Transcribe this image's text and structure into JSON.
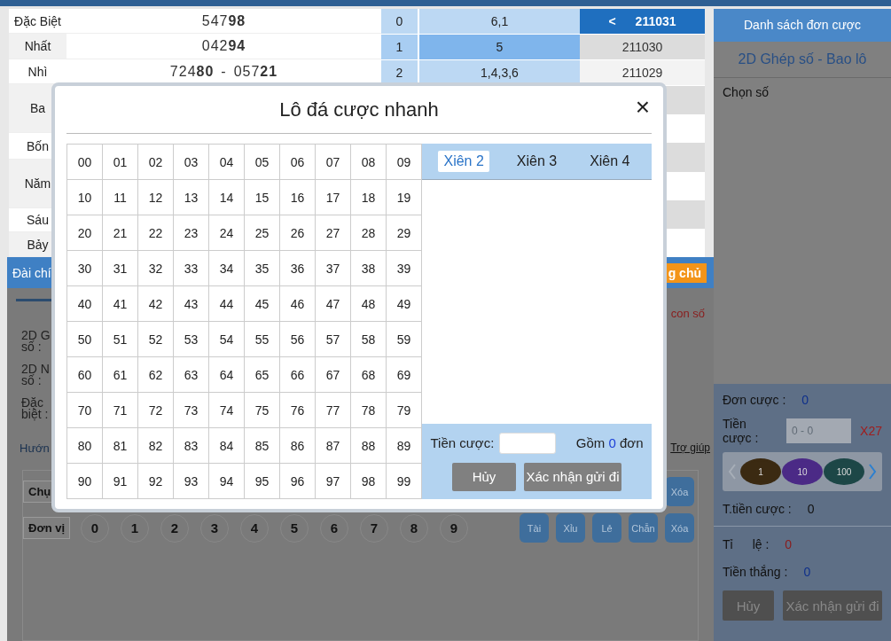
{
  "results": [
    {
      "label": "Đặc Biệt",
      "value": "547**98**"
    },
    {
      "label": "Nhất",
      "value": "042**94**"
    },
    {
      "label": "Nhì",
      "values": [
        "724**80**",
        "057**21**"
      ],
      "separator": "-"
    },
    {
      "label": "Ba"
    },
    {
      "label": "Bốn"
    },
    {
      "label": "Năm"
    },
    {
      "label": "Sáu"
    },
    {
      "label": "Bảy"
    }
  ],
  "heads": [
    {
      "digit": "0",
      "tails": "6,1",
      "highlighted": false
    },
    {
      "digit": "1",
      "tails": "5",
      "highlighted": true
    },
    {
      "digit": "2",
      "tails": "1,4,3,6",
      "highlighted": false
    }
  ],
  "draws": {
    "prev": "<",
    "items": [
      {
        "id": "211031",
        "selected": true
      },
      {
        "id": "211030",
        "selected": false
      },
      {
        "id": "211029",
        "selected": false
      }
    ]
  },
  "lower": {
    "station_bar": "Đài chí",
    "station_button": "g chủ",
    "hint": "con số",
    "fields": [
      {
        "lines": [
          "2D G",
          "số :"
        ]
      },
      {
        "lines": [
          "2D N",
          "số :"
        ]
      },
      {
        "lines": [
          "Đặc",
          "biệt :"
        ]
      }
    ],
    "guide_link": "Hướn",
    "help_link": "Trợ giúp",
    "rows": [
      {
        "button": "Chụ",
        "actions": [
          "Xóa"
        ]
      },
      {
        "button": "Đơn vị",
        "digits": [
          "0",
          "1",
          "2",
          "3",
          "4",
          "5",
          "6",
          "7",
          "8",
          "9"
        ],
        "actions": [
          "Tài",
          "Xỉu",
          "Lẻ",
          "Chẵn",
          "Xóa"
        ]
      }
    ]
  },
  "slip": {
    "title": "Danh sách đơn cược",
    "game": "2D Ghép số - Bao lô",
    "choose": "Chọn số",
    "count": {
      "label": "Đơn cược :",
      "value": "0"
    },
    "amount": {
      "label": "Tiền cược :",
      "placeholder": "0 - 0",
      "multiplier": "X27"
    },
    "chips": [
      {
        "label": "1",
        "color": "#3b2a12"
      },
      {
        "label": "10",
        "color": "#4b2a86"
      },
      {
        "label": "100",
        "color": "#1d4747"
      }
    ],
    "total": {
      "label": "T.tiền cược :",
      "value": "0"
    },
    "rate": {
      "label": "Tỉ",
      "label2": "lệ :",
      "value": "0"
    },
    "win": {
      "label": "Tiền thắng :",
      "value": "0"
    },
    "buttons": [
      "Hủy",
      "Xác nhận gửi đi"
    ]
  },
  "modal": {
    "title": "Lô đá cược nhanh",
    "close": "×",
    "grid": [
      [
        "00",
        "01",
        "02",
        "03",
        "04",
        "05",
        "06",
        "07",
        "08",
        "09"
      ],
      [
        "10",
        "11",
        "12",
        "13",
        "14",
        "15",
        "16",
        "17",
        "18",
        "19"
      ],
      [
        "20",
        "21",
        "22",
        "23",
        "24",
        "25",
        "26",
        "27",
        "28",
        "29"
      ],
      [
        "30",
        "31",
        "32",
        "33",
        "34",
        "35",
        "36",
        "37",
        "38",
        "39"
      ],
      [
        "40",
        "41",
        "42",
        "43",
        "44",
        "45",
        "46",
        "47",
        "48",
        "49"
      ],
      [
        "50",
        "51",
        "52",
        "53",
        "54",
        "55",
        "56",
        "57",
        "58",
        "59"
      ],
      [
        "60",
        "61",
        "62",
        "63",
        "64",
        "65",
        "66",
        "67",
        "68",
        "69"
      ],
      [
        "70",
        "71",
        "72",
        "73",
        "74",
        "75",
        "76",
        "77",
        "78",
        "79"
      ],
      [
        "80",
        "81",
        "82",
        "83",
        "84",
        "85",
        "86",
        "87",
        "88",
        "89"
      ],
      [
        "90",
        "91",
        "92",
        "93",
        "94",
        "95",
        "96",
        "97",
        "98",
        "99"
      ]
    ],
    "tabs": [
      {
        "label": "Xiên 2",
        "selected": true
      },
      {
        "label": "Xiên 3",
        "selected": false
      },
      {
        "label": "Xiên 4",
        "selected": false
      }
    ],
    "amount_label": "Tiền cược:",
    "summary": {
      "prefix": "Gồm",
      "count": "0",
      "suffix": "đơn"
    },
    "buttons": [
      "Hủy",
      "Xác nhận gửi đi"
    ]
  }
}
